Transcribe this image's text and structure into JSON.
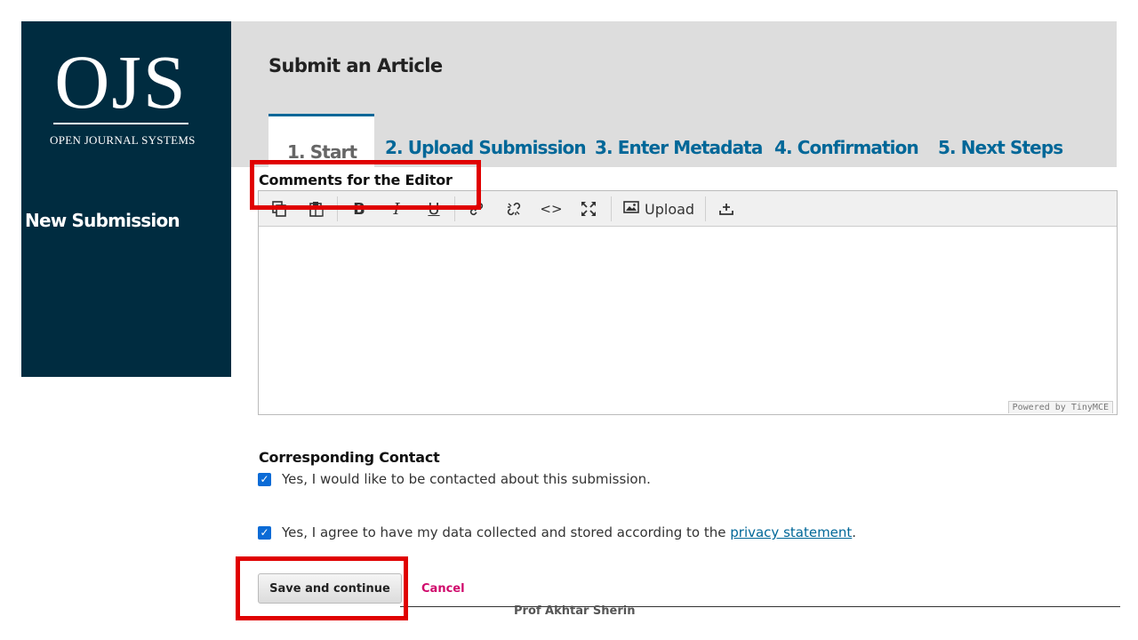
{
  "sidebar": {
    "logo_mark": "OJS",
    "logo_subtitle": "OPEN JOURNAL SYSTEMS",
    "nav_item": "New Submission"
  },
  "header": {
    "title": "Submit an Article",
    "tabs": [
      {
        "label": "1. Start"
      },
      {
        "label": "2. Upload Submission"
      },
      {
        "label": "3. Enter Metadata"
      },
      {
        "label": "4. Confirmation"
      },
      {
        "label": "5. Next Steps"
      }
    ],
    "active_tab": "1. Start"
  },
  "editor": {
    "label": "Comments for the Editor",
    "toolbar": {
      "upload_label": "Upload",
      "bold": "B",
      "italic": "I",
      "underline": "U",
      "code": "<>"
    },
    "powered_by": "Powered by TinyMCE"
  },
  "contact": {
    "label": "Corresponding Contact",
    "checkbox1": "Yes, I would like to be contacted about this submission.",
    "checkbox2_pre": "Yes, I agree to have my data collected and stored according to the ",
    "checkbox2_link": "privacy statement",
    "checkbox2_post": "."
  },
  "actions": {
    "save": "Save and continue",
    "cancel": "Cancel"
  },
  "footer": {
    "author": "Prof Akhtar Sherin"
  },
  "colors": {
    "sidebar": "#002c40",
    "header": "#dddddd",
    "link": "#006798",
    "cancel": "#d00a6c",
    "annotation": "#e00000",
    "checkbox": "#0b6bd6"
  }
}
